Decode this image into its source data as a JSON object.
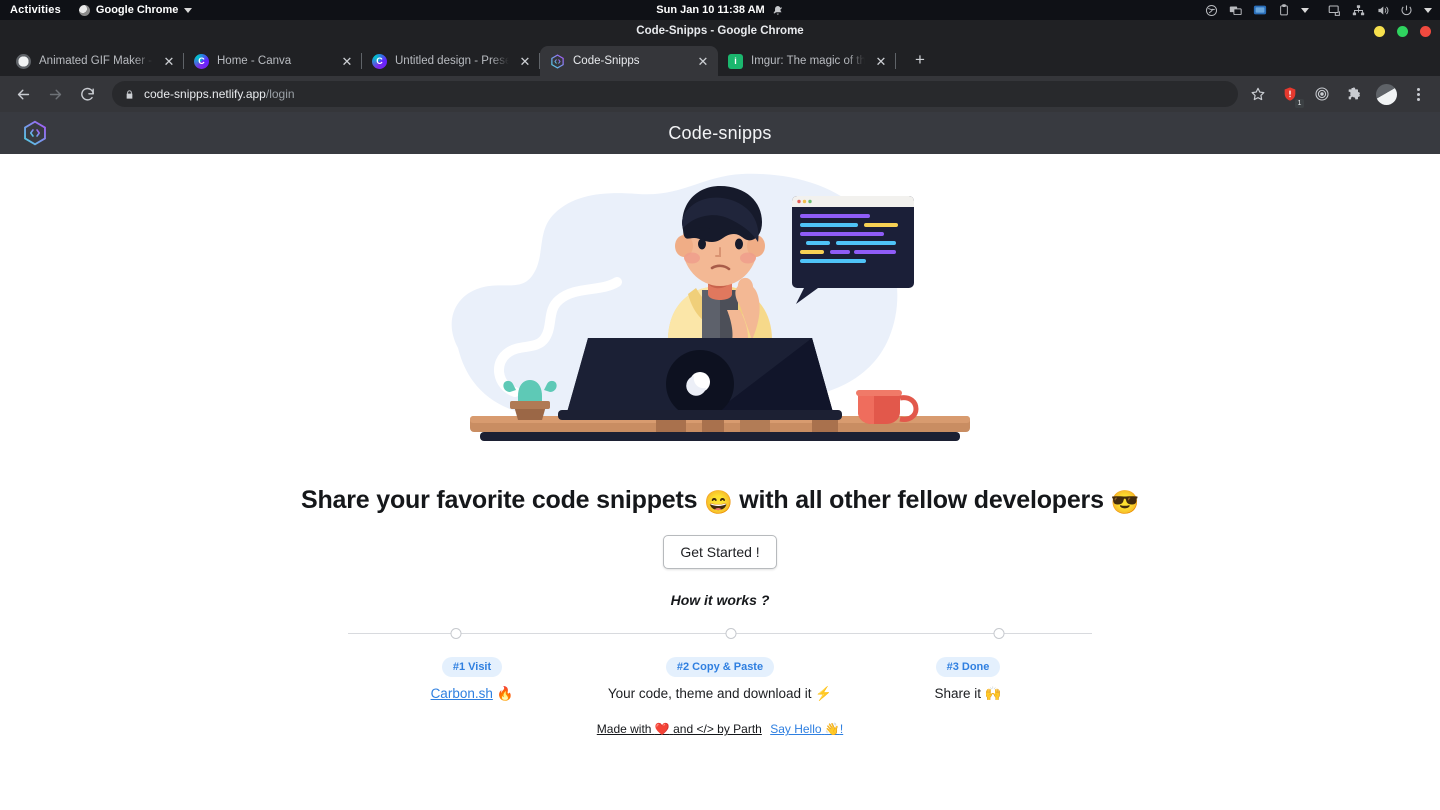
{
  "gnome": {
    "activities": "Activities",
    "app_name": "Google Chrome",
    "datetime": "Sun Jan 10  11:38 AM",
    "tray": [
      "record-icon",
      "screencast-icon",
      "display-icon",
      "clipboard-icon",
      "caret-down-icon",
      "screen-share-icon",
      "network-icon",
      "volume-icon",
      "power-icon",
      "caret-down-icon"
    ]
  },
  "window": {
    "title": "Code-Snipps - Google Chrome",
    "controls": {
      "minimize": "minimize-button",
      "maximize": "maximize-button",
      "close": "close-button"
    }
  },
  "tabs": [
    {
      "title": "Animated GIF Maker - Make GI",
      "favicon": "globe",
      "active": false
    },
    {
      "title": "Home - Canva",
      "favicon": "canva",
      "active": false
    },
    {
      "title": "Untitled design - Presentatio",
      "favicon": "canva",
      "active": false
    },
    {
      "title": "Code-Snipps",
      "favicon": "snipps",
      "active": true
    },
    {
      "title": "Imgur: The magic of the Inter",
      "favicon": "imgur",
      "active": false
    }
  ],
  "tab_strip": {
    "new_tab_label": "+",
    "close_label": "✕"
  },
  "toolbar": {
    "back": "back-button",
    "forward": "forward-button",
    "reload": "reload-button",
    "url_host": "code-snipps.netlify.app",
    "url_path": "/login",
    "lock": "lock-icon",
    "bookmark": "star-icon",
    "extension_badge_count": "1",
    "icons": [
      "star-icon",
      "extension-red-icon",
      "target-icon",
      "puzzle-icon",
      "profile-avatar",
      "kebab-menu"
    ]
  },
  "site": {
    "logo_glyph": "</>",
    "title": "Code-snipps"
  },
  "hero": {
    "headline_part1": "Share your favorite code snippets",
    "headline_emoji1": "😄",
    "headline_part2": "with all other fellow developers",
    "headline_emoji2": "😎",
    "cta_label": "Get Started !",
    "how_it_works": "How it works ?"
  },
  "steps": [
    {
      "badge": "#1 Visit",
      "text": "Carbon.sh",
      "emoji": "🔥",
      "is_link": true
    },
    {
      "badge": "#2 Copy & Paste",
      "text": "Your code, theme and download it",
      "emoji": "⚡",
      "is_link": false
    },
    {
      "badge": "#3 Done",
      "text": "Share it",
      "emoji": "🙌",
      "is_link": false
    }
  ],
  "footer": {
    "made_with_prefix": "Made with",
    "heart": "❤️",
    "made_with_mid": "and </> by Parth",
    "say_hello": "Say Hello",
    "wave": "👋",
    "bang": "!"
  },
  "colors": {
    "gnome_bar": "#0f1116",
    "chrome_frame": "#202124",
    "chrome_toolbar": "#35363a",
    "site_header": "#383a40",
    "accent_blue": "#2e7fe0",
    "badge_bg": "#e4f0fd",
    "illustration_blob": "#eaf0fa"
  }
}
